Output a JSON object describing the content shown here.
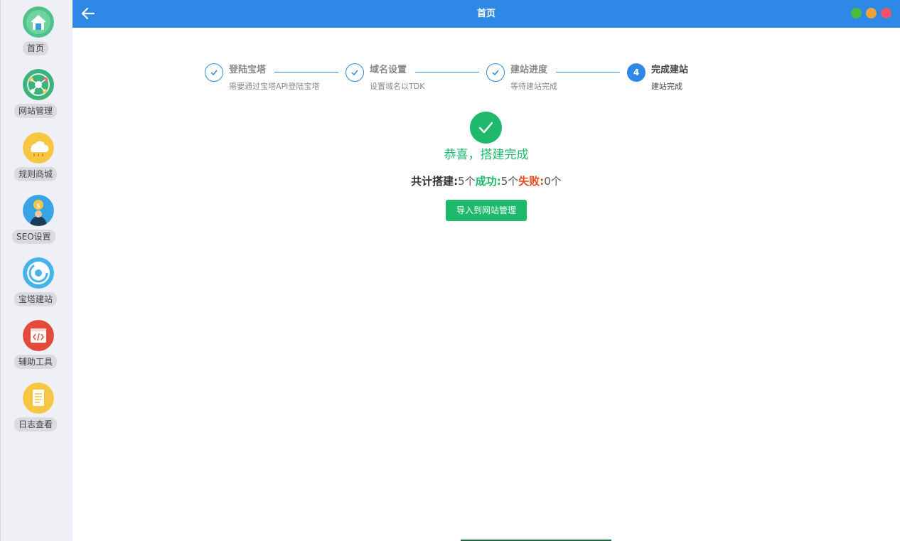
{
  "sidebar": {
    "items": [
      {
        "label": "首页",
        "icon": "home-icon"
      },
      {
        "label": "网站管理",
        "icon": "network-icon"
      },
      {
        "label": "规则商城",
        "icon": "cloud-icon"
      },
      {
        "label": "SEO设置",
        "icon": "person-icon"
      },
      {
        "label": "宝塔建站",
        "icon": "refresh-icon"
      },
      {
        "label": "辅助工具",
        "icon": "code-icon"
      },
      {
        "label": "日志查看",
        "icon": "document-icon"
      }
    ]
  },
  "header": {
    "title": "首页"
  },
  "window_controls": [
    {
      "name": "minimize",
      "color": "#4cba3c"
    },
    {
      "name": "maximize",
      "color": "#eda33c"
    },
    {
      "name": "close",
      "color": "#f0546c"
    }
  ],
  "steps": [
    {
      "title": "登陆宝塔",
      "desc": "需要通过宝塔API登陆宝塔",
      "status": "done"
    },
    {
      "title": "域名设置",
      "desc": "设置域名以TDK",
      "status": "done"
    },
    {
      "title": "建站进度",
      "desc": "等待建站完成",
      "status": "done"
    },
    {
      "number": "4",
      "title": "完成建站",
      "desc": "建站完成",
      "status": "active"
    }
  ],
  "result": {
    "title": "恭喜，搭建完成",
    "total_label": "共计搭建:",
    "total_value": "5个",
    "success_label": "成功:",
    "success_value": "5个",
    "fail_label": "失败:",
    "fail_value": "0个",
    "import_button": "导入到网站管理"
  },
  "colors": {
    "primary": "#2e88e5",
    "success": "#1eb96c",
    "fail": "#e84c1d"
  }
}
